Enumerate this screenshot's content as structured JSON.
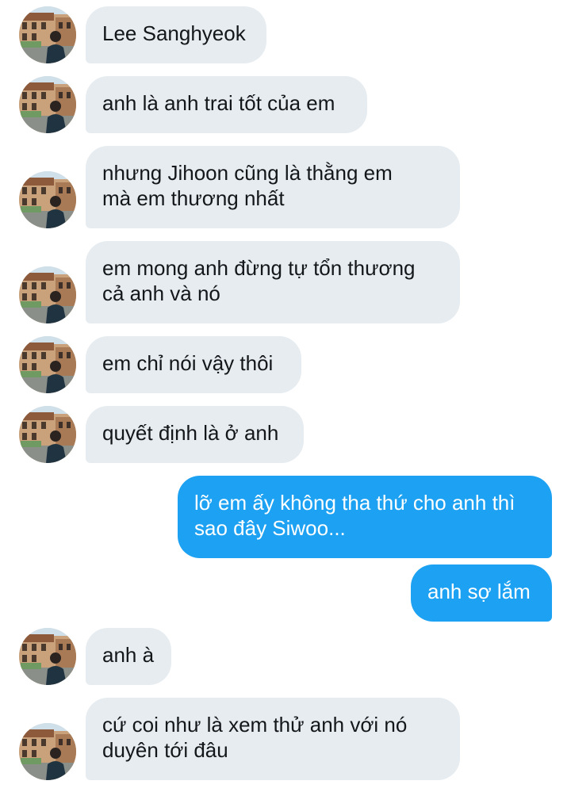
{
  "conversation": {
    "messages": [
      {
        "sender": "them",
        "text": "Lee Sanghyeok"
      },
      {
        "sender": "them",
        "text": "anh là anh trai tốt của em"
      },
      {
        "sender": "them",
        "text": "nhưng Jihoon cũng là thằng em\nmà em thương nhất"
      },
      {
        "sender": "them",
        "text": "em mong anh đừng tự tổn thương\ncả anh và nó"
      },
      {
        "sender": "them",
        "text": "em chỉ nói vậy thôi"
      },
      {
        "sender": "them",
        "text": "quyết định là ở anh"
      },
      {
        "sender": "me",
        "text": "lỡ em ấy không tha thứ cho anh thì\nsao đây Siwoo..."
      },
      {
        "sender": "me",
        "text": "anh sợ lắm"
      },
      {
        "sender": "them",
        "text": "anh à"
      },
      {
        "sender": "them",
        "text": "cứ coi như là xem thử anh với nó\nduyên tới đâu"
      }
    ]
  },
  "colors": {
    "incoming_bubble": "#e6ecf0",
    "outgoing_bubble": "#1da1f2",
    "incoming_text": "#14171a",
    "outgoing_text": "#ffffff"
  }
}
